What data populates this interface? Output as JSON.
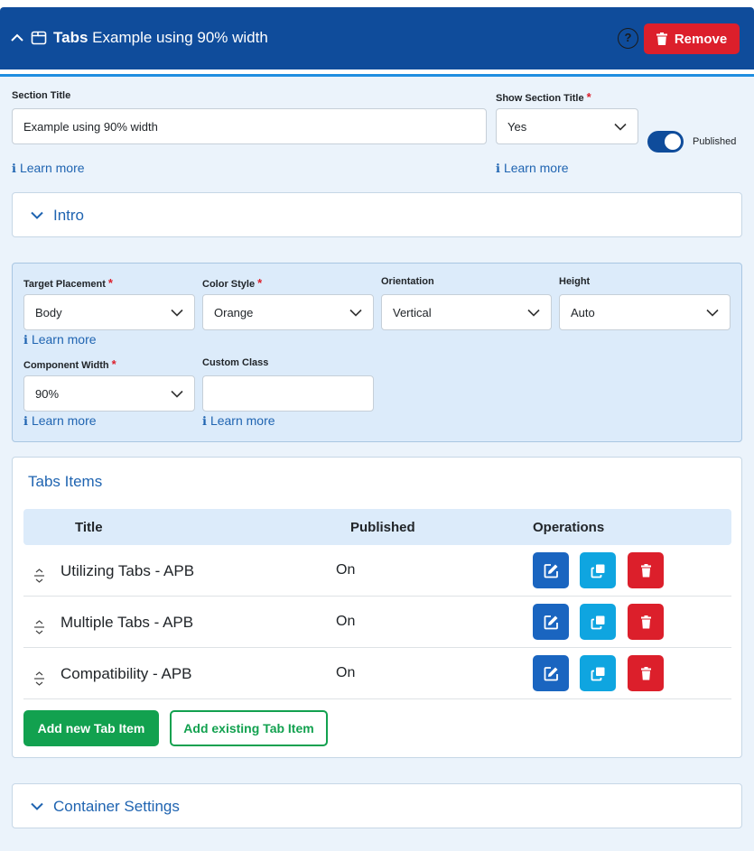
{
  "header": {
    "type_label": "Tabs",
    "section_name": "Example using 90% width",
    "help_label": "?",
    "remove_label": "Remove"
  },
  "section_title": {
    "label": "Section Title",
    "value": "Example using 90% width",
    "learn_more": "Learn more"
  },
  "show_section_title": {
    "label": "Show Section Title",
    "required_mark": "*",
    "value": "Yes",
    "learn_more": "Learn more"
  },
  "published_toggle": {
    "label": "Published",
    "on": true
  },
  "intro": {
    "title": "Intro"
  },
  "settings": {
    "target_placement": {
      "label": "Target Placement",
      "required_mark": "*",
      "value": "Body",
      "learn_more": "Learn more"
    },
    "color_style": {
      "label": "Color Style",
      "required_mark": "*",
      "value": "Orange"
    },
    "orientation": {
      "label": "Orientation",
      "value": "Vertical"
    },
    "height": {
      "label": "Height",
      "value": "Auto"
    },
    "component_width": {
      "label": "Component Width",
      "required_mark": "*",
      "value": "90%",
      "learn_more": "Learn more"
    },
    "custom_class": {
      "label": "Custom Class",
      "value": "",
      "learn_more": "Learn more"
    }
  },
  "tabs_items": {
    "title": "Tabs Items",
    "columns": [
      "Title",
      "Published",
      "Operations"
    ],
    "rows": [
      {
        "title": "Utilizing Tabs - APB",
        "published": "On"
      },
      {
        "title": "Multiple Tabs - APB",
        "published": "On"
      },
      {
        "title": "Compatibility - APB",
        "published": "On"
      }
    ],
    "add_new_label": "Add new Tab Item",
    "add_existing_label": "Add existing Tab Item"
  },
  "container_settings": {
    "title": "Container Settings"
  },
  "icons": {
    "collapse": "chevron-up-icon",
    "tabs": "tabs-icon",
    "help": "question-circle-icon",
    "trash": "trash-icon",
    "info": "info-icon",
    "dropdown": "chevron-down-icon",
    "drag": "drag-handle-icon",
    "edit": "edit-icon",
    "copy": "copy-icon"
  },
  "colors": {
    "header_bg": "#0f4c9b",
    "accent_blue": "#1f64b1",
    "danger": "#dc1f2b",
    "success": "#12a14f",
    "info": "#0fa5e0",
    "panel_bg": "#ebf3fb"
  }
}
